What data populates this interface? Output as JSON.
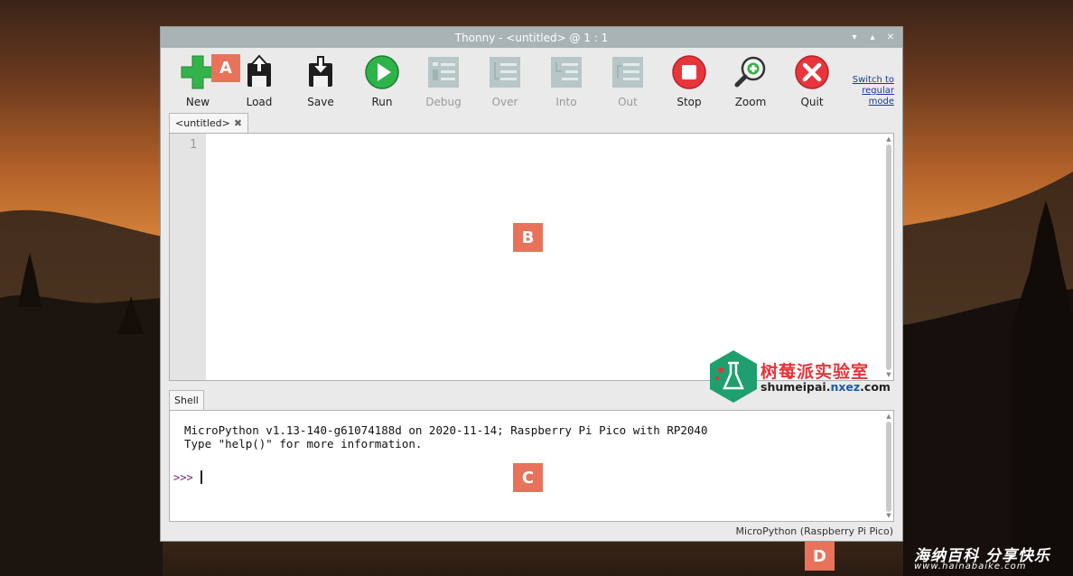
{
  "window": {
    "title": "Thonny  -  <untitled>  @  1 : 1",
    "controls": [
      "minimize",
      "maximize",
      "close"
    ]
  },
  "toolbar": {
    "buttons": [
      {
        "label": "New",
        "icon": "new-plus-icon",
        "enabled": true
      },
      {
        "label": "Load",
        "icon": "load-floppy-icon",
        "enabled": true
      },
      {
        "label": "Save",
        "icon": "save-floppy-icon",
        "enabled": true
      },
      {
        "label": "Run",
        "icon": "run-play-icon",
        "enabled": true
      },
      {
        "label": "Debug",
        "icon": "debug-icon",
        "enabled": false
      },
      {
        "label": "Over",
        "icon": "step-over-icon",
        "enabled": false
      },
      {
        "label": "Into",
        "icon": "step-into-icon",
        "enabled": false
      },
      {
        "label": "Out",
        "icon": "step-out-icon",
        "enabled": false
      },
      {
        "label": "Stop",
        "icon": "stop-icon",
        "enabled": true
      },
      {
        "label": "Zoom",
        "icon": "zoom-icon",
        "enabled": true
      },
      {
        "label": "Quit",
        "icon": "quit-icon",
        "enabled": true
      }
    ],
    "switch_mode": {
      "line1": "Switch to",
      "line2": "regular",
      "line3": "mode"
    }
  },
  "editor": {
    "tab_label": "<untitled>",
    "line_numbers": [
      "1"
    ]
  },
  "shell": {
    "tab_label": "Shell",
    "lines": [
      "MicroPython v1.13-140-g61074188d on 2020-11-14; Raspberry Pi Pico with RP2040",
      "Type \"help()\" for more information."
    ],
    "prompt": ">>>"
  },
  "status": {
    "interpreter": "MicroPython (Raspberry Pi Pico)"
  },
  "markers": [
    "A",
    "B",
    "C",
    "D"
  ],
  "watermarks": {
    "site1_title": "树莓派实验室",
    "site1_url_a": "shumeipai.",
    "site1_url_b": "nxez",
    "site1_url_c": ".com",
    "site2_title": "海纳百科 分享快乐",
    "site2_url": "www.hainabaike.com"
  },
  "colors": {
    "accent_marker": "#e8735a",
    "titlebar": "#a9b3b5",
    "run_green": "#2db34a",
    "stop_red": "#e8353b"
  }
}
